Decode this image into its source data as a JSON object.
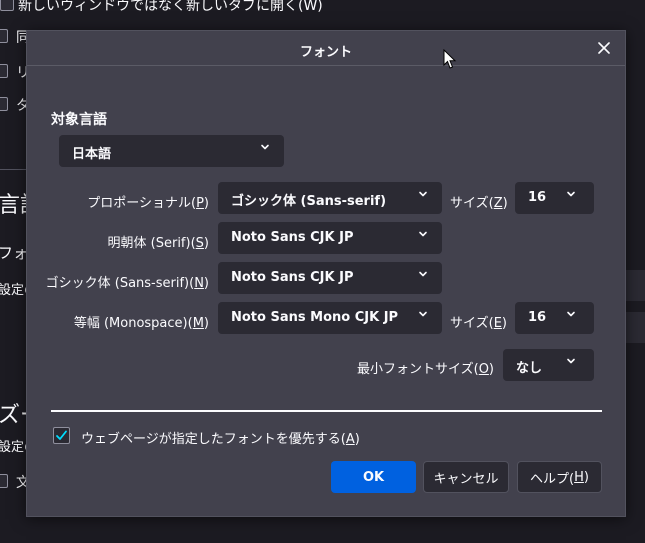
{
  "background": {
    "line1": "新しいウィンドウではなく新しいタブに開く(W)",
    "line2_char": "同",
    "line3_char": "リ",
    "line4_char": "タ",
    "heading1": "言語",
    "line5": "フォ",
    "line6": "設定の",
    "heading2": "ズー",
    "line7": "設定の",
    "line8_char": "文"
  },
  "dialog": {
    "title": "フォント",
    "close_icon": "close-icon",
    "section_title": "対象言語",
    "language": "日本語",
    "proportional": {
      "label_pre": "プロポーショナル(",
      "label_key": "P",
      "label_post": ")",
      "value": "ゴシック体 (Sans-serif)",
      "size_label_pre": "サイズ(",
      "size_label_key": "Z",
      "size_label_post": ")",
      "size_value": "16"
    },
    "serif": {
      "label_pre": "明朝体 (Serif)(",
      "label_key": "S",
      "label_post": ")",
      "value": "Noto Sans CJK JP"
    },
    "sans_serif": {
      "label_pre": "ゴシック体 (Sans-serif)(",
      "label_key": "N",
      "label_post": ")",
      "value": "Noto Sans CJK JP"
    },
    "monospace": {
      "label_pre": "等幅 (Monospace)(",
      "label_key": "M",
      "label_post": ")",
      "value": "Noto Sans Mono CJK JP",
      "size_label_pre": "サイズ(",
      "size_label_key": "E",
      "size_label_post": ")",
      "size_value": "16"
    },
    "min_size": {
      "label_pre": "最小フォントサイズ(",
      "label_key": "O",
      "label_post": ")",
      "value": "なし"
    },
    "allow_pages_fonts": {
      "checked": true,
      "label_pre": "ウェブページが指定したフォントを優先する(",
      "label_key": "A",
      "label_post": ")"
    },
    "buttons": {
      "ok": "OK",
      "cancel": "キャンセル",
      "help_pre": "ヘルプ(",
      "help_key": "H",
      "help_post": ")"
    }
  },
  "colors": {
    "accent": "#0061e0",
    "dialog_bg": "#42414d",
    "field_bg": "#2b2a33",
    "page_bg": "#1c1b22"
  }
}
